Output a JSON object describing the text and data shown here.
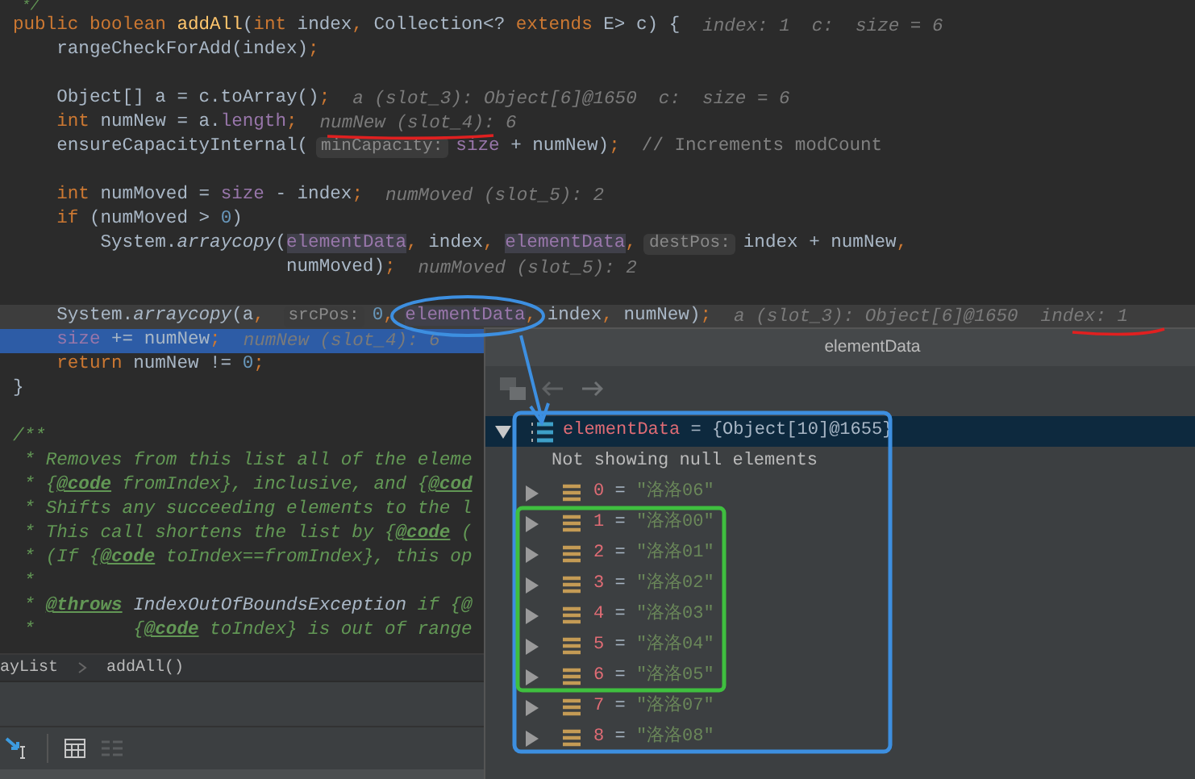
{
  "editor": {
    "blocks": [
      {
        "lines": [
          {
            "segments": [
              {
                "kind": "code",
                "tokens": [
                  {
                    "kind": "doc",
                    "text": " */"
                  }
                ]
              }
            ]
          },
          {
            "segments": [
              {
                "kind": "code",
                "tokens": [
                  {
                    "kind": "kw",
                    "text": "public boolean "
                  },
                  {
                    "kind": "decl",
                    "text": "addAll"
                  },
                  {
                    "kind": "plain",
                    "text": "("
                  },
                  {
                    "kind": "kw",
                    "text": "int "
                  },
                  {
                    "kind": "plain",
                    "text": "index"
                  },
                  {
                    "kind": "kw",
                    "text": ", "
                  },
                  {
                    "kind": "plain",
                    "text": "Collection<? "
                  },
                  {
                    "kind": "kw",
                    "text": "extends "
                  },
                  {
                    "kind": "plain",
                    "text": "E> c) {"
                  }
                ]
              },
              {
                "kind": "value",
                "text": "index: 1  c:  size = 6"
              }
            ]
          },
          {
            "segments": [
              {
                "kind": "code",
                "tokens": [
                  {
                    "kind": "plain",
                    "text": "    rangeCheckForAdd(index)"
                  },
                  {
                    "kind": "kw",
                    "text": ";"
                  }
                ]
              }
            ]
          }
        ]
      },
      {
        "lines": [
          {
            "segments": [
              {
                "kind": "code",
                "tokens": [
                  {
                    "kind": "plain",
                    "text": "    Object[] a = c.toArray()"
                  },
                  {
                    "kind": "kw",
                    "text": ";"
                  }
                ]
              },
              {
                "kind": "value",
                "text": "a (slot_3): Object[6]@1650  c:  size = 6"
              }
            ]
          },
          {
            "segments": [
              {
                "kind": "code",
                "tokens": [
                  {
                    "kind": "kw",
                    "text": "    int "
                  },
                  {
                    "kind": "plain",
                    "text": "numNew = a."
                  },
                  {
                    "kind": "field",
                    "text": "length"
                  },
                  {
                    "kind": "kw",
                    "text": ";"
                  }
                ]
              },
              {
                "kind": "value",
                "text": "numNew (slot_4): 6"
              }
            ]
          },
          {
            "segments": [
              {
                "kind": "code",
                "tokens": [
                  {
                    "kind": "plain",
                    "text": "    ensureCapacityInternal("
                  }
                ]
              },
              {
                "kind": "param",
                "text": "minCapacity:"
              },
              {
                "kind": "code",
                "tokens": [
                  {
                    "kind": "field",
                    "text": "size "
                  },
                  {
                    "kind": "plain",
                    "text": "+ numNew)"
                  },
                  {
                    "kind": "kw",
                    "text": ";"
                  },
                  {
                    "kind": "comment",
                    "text": "  // Increments modCount"
                  }
                ]
              }
            ]
          }
        ]
      },
      {
        "lines": [
          {
            "segments": [
              {
                "kind": "code",
                "tokens": [
                  {
                    "kind": "kw",
                    "text": "    int "
                  },
                  {
                    "kind": "plain",
                    "text": "numMoved = "
                  },
                  {
                    "kind": "field",
                    "text": "size "
                  },
                  {
                    "kind": "plain",
                    "text": "- index"
                  },
                  {
                    "kind": "kw",
                    "text": ";"
                  }
                ]
              },
              {
                "kind": "value",
                "text": "numMoved (slot_5): 2"
              }
            ]
          },
          {
            "segments": [
              {
                "kind": "code",
                "tokens": [
                  {
                    "kind": "kw",
                    "text": "    if "
                  },
                  {
                    "kind": "plain",
                    "text": "(numMoved > "
                  },
                  {
                    "kind": "num",
                    "text": "0"
                  },
                  {
                    "kind": "plain",
                    "text": ")"
                  }
                ]
              }
            ]
          },
          {
            "segments": [
              {
                "kind": "code",
                "tokens": [
                  {
                    "kind": "plain",
                    "text": "        System."
                  },
                  {
                    "kind": "static",
                    "text": "arraycopy"
                  },
                  {
                    "kind": "plain",
                    "text": "("
                  },
                  {
                    "kind": "usage",
                    "text": "elementData"
                  },
                  {
                    "kind": "kw",
                    "text": ", "
                  },
                  {
                    "kind": "plain",
                    "text": "index"
                  },
                  {
                    "kind": "kw",
                    "text": ", "
                  },
                  {
                    "kind": "usage",
                    "text": "elementData"
                  },
                  {
                    "kind": "kw",
                    "text": ","
                  }
                ]
              },
              {
                "kind": "param",
                "text": "destPos:"
              },
              {
                "kind": "code",
                "tokens": [
                  {
                    "kind": "plain",
                    "text": "index + numNew"
                  },
                  {
                    "kind": "kw",
                    "text": ","
                  }
                ]
              }
            ]
          },
          {
            "segments": [
              {
                "kind": "code",
                "tokens": [
                  {
                    "kind": "plain",
                    "text": "                         numMoved)"
                  },
                  {
                    "kind": "kw",
                    "text": ";"
                  }
                ]
              },
              {
                "kind": "value",
                "text": "numMoved (slot_5): 2"
              }
            ]
          }
        ]
      },
      {
        "lines": [
          {
            "current": true,
            "execution": false,
            "segments": [
              {
                "kind": "code",
                "tokens": [
                  {
                    "kind": "plain",
                    "text": "    System."
                  },
                  {
                    "kind": "static",
                    "text": "arraycopy"
                  },
                  {
                    "kind": "plain",
                    "text": "(a"
                  },
                  {
                    "kind": "kw",
                    "text": ", "
                  }
                ]
              },
              {
                "kind": "param",
                "text": "srcPos:"
              },
              {
                "kind": "code",
                "tokens": [
                  {
                    "kind": "num",
                    "text": "0"
                  },
                  {
                    "kind": "kw",
                    "text": ", "
                  },
                  {
                    "kind": "usage",
                    "text": "elementData"
                  },
                  {
                    "kind": "kw",
                    "text": ", "
                  },
                  {
                    "kind": "plain",
                    "text": "index"
                  },
                  {
                    "kind": "kw",
                    "text": ", "
                  },
                  {
                    "kind": "plain",
                    "text": "numNew)"
                  },
                  {
                    "kind": "kw",
                    "text": ";"
                  }
                ]
              },
              {
                "kind": "value",
                "text": "a (slot_3): Object[6]@1650"
              },
              {
                "kind": "value",
                "text": "index: 1"
              }
            ]
          },
          {
            "current": false,
            "execution": true,
            "segments": [
              {
                "kind": "code",
                "tokens": [
                  {
                    "kind": "field",
                    "text": "    size "
                  },
                  {
                    "kind": "plain",
                    "text": "+= numNew"
                  },
                  {
                    "kind": "kw",
                    "text": ";"
                  }
                ]
              },
              {
                "kind": "value",
                "text": "numNew (slot_4): 6"
              }
            ]
          },
          {
            "segments": [
              {
                "kind": "code",
                "tokens": [
                  {
                    "kind": "kw",
                    "text": "    return "
                  },
                  {
                    "kind": "plain",
                    "text": "numNew != "
                  },
                  {
                    "kind": "num",
                    "text": "0"
                  },
                  {
                    "kind": "kw",
                    "text": ";"
                  }
                ]
              }
            ]
          },
          {
            "segments": [
              {
                "kind": "code",
                "tokens": [
                  {
                    "kind": "plain",
                    "text": "}"
                  }
                ]
              }
            ]
          }
        ]
      },
      {
        "lines": [
          {
            "segments": [
              {
                "kind": "code",
                "tokens": [
                  {
                    "kind": "doc",
                    "text": "/**"
                  }
                ]
              }
            ]
          },
          {
            "segments": [
              {
                "kind": "code",
                "tokens": [
                  {
                    "kind": "doc",
                    "text": " * Removes from this list all of the eleme"
                  }
                ]
              }
            ]
          },
          {
            "segments": [
              {
                "kind": "code",
                "tokens": [
                  {
                    "kind": "doc",
                    "text": " * {"
                  },
                  {
                    "kind": "tag",
                    "text": "@code"
                  },
                  {
                    "kind": "doc",
                    "text": " fromIndex}, inclusive, and {"
                  },
                  {
                    "kind": "tag",
                    "text": "@cod"
                  }
                ]
              }
            ]
          },
          {
            "segments": [
              {
                "kind": "code",
                "tokens": [
                  {
                    "kind": "doc",
                    "text": " * Shifts any succeeding elements to the l"
                  }
                ]
              }
            ]
          },
          {
            "segments": [
              {
                "kind": "code",
                "tokens": [
                  {
                    "kind": "doc",
                    "text": " * This call shortens the list by {"
                  },
                  {
                    "kind": "tag",
                    "text": "@code"
                  },
                  {
                    "kind": "doc",
                    "text": " ("
                  }
                ]
              }
            ]
          },
          {
            "segments": [
              {
                "kind": "code",
                "tokens": [
                  {
                    "kind": "doc",
                    "text": " * (If {"
                  },
                  {
                    "kind": "tag",
                    "text": "@code"
                  },
                  {
                    "kind": "doc",
                    "text": " toIndex==fromIndex}, this op"
                  }
                ]
              }
            ]
          },
          {
            "segments": [
              {
                "kind": "code",
                "tokens": [
                  {
                    "kind": "doc",
                    "text": " *"
                  }
                ]
              }
            ]
          },
          {
            "segments": [
              {
                "kind": "code",
                "tokens": [
                  {
                    "kind": "doc",
                    "text": " * "
                  },
                  {
                    "kind": "tag",
                    "text": "@throws"
                  },
                  {
                    "kind": "docref",
                    "text": " IndexOutOfBoundsException"
                  },
                  {
                    "kind": "doc",
                    "text": " if {@"
                  }
                ]
              }
            ]
          },
          {
            "segments": [
              {
                "kind": "code",
                "tokens": [
                  {
                    "kind": "doc",
                    "text": " *         {"
                  },
                  {
                    "kind": "tag",
                    "text": "@code"
                  },
                  {
                    "kind": "doc",
                    "text": " toIndex} is out of range"
                  }
                ]
              }
            ]
          }
        ]
      }
    ]
  },
  "breadcrumbs": [
    "ayList",
    "addAll()"
  ],
  "popup": {
    "title": "elementData",
    "tree": {
      "name": "elementData",
      "operator": "=",
      "value": "{Object[10]@1655}",
      "expanded": true,
      "selected": true,
      "note": "Not showing null elements",
      "children": [
        {
          "name": "0",
          "operator": "=",
          "value": "\"洛洛06\"",
          "expanded": false
        },
        {
          "name": "1",
          "operator": "=",
          "value": "\"洛洛00\"",
          "expanded": false
        },
        {
          "name": "2",
          "operator": "=",
          "value": "\"洛洛01\"",
          "expanded": false
        },
        {
          "name": "3",
          "operator": "=",
          "value": "\"洛洛02\"",
          "expanded": false
        },
        {
          "name": "4",
          "operator": "=",
          "value": "\"洛洛03\"",
          "expanded": false
        },
        {
          "name": "5",
          "operator": "=",
          "value": "\"洛洛04\"",
          "expanded": false
        },
        {
          "name": "6",
          "operator": "=",
          "value": "\"洛洛05\"",
          "expanded": false
        },
        {
          "name": "7",
          "operator": "=",
          "value": "\"洛洛07\"",
          "expanded": false
        },
        {
          "name": "8",
          "operator": "=",
          "value": "\"洛洛08\"",
          "expanded": false
        }
      ]
    }
  }
}
